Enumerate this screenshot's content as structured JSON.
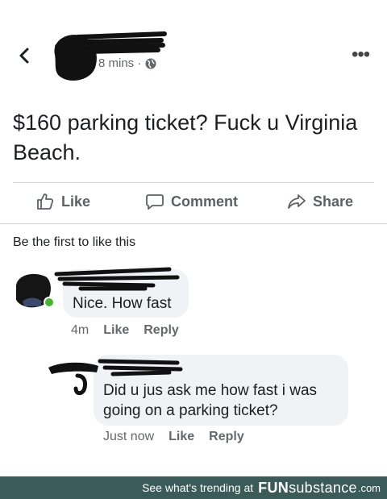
{
  "post": {
    "time": "8 mins ·",
    "text": "$160 parking ticket? Fuck u Virginia Beach.",
    "icons": {
      "back": "back-chevron-icon",
      "privacy": "globe-icon",
      "more": "more-dots-icon"
    }
  },
  "actions": {
    "like": "Like",
    "comment": "Comment",
    "share": "Share"
  },
  "reactions_text": "Be the first to like this",
  "comments": [
    {
      "text": "Nice. How fast",
      "time": "4m",
      "like": "Like",
      "reply": "Reply"
    },
    {
      "text": "Did u jus ask me how fast i was going on a parking ticket?",
      "time": "Just now",
      "like": "Like",
      "reply": "Reply"
    }
  ],
  "footer": {
    "trending": "See what's trending at",
    "brand_bold": "FUN",
    "brand_rest": "substance",
    "domain": ".com"
  },
  "colors": {
    "footer_bg": "#3b5b5a",
    "bubble": "#f0f2f5",
    "meta": "#65676b",
    "online": "#42b72a"
  }
}
